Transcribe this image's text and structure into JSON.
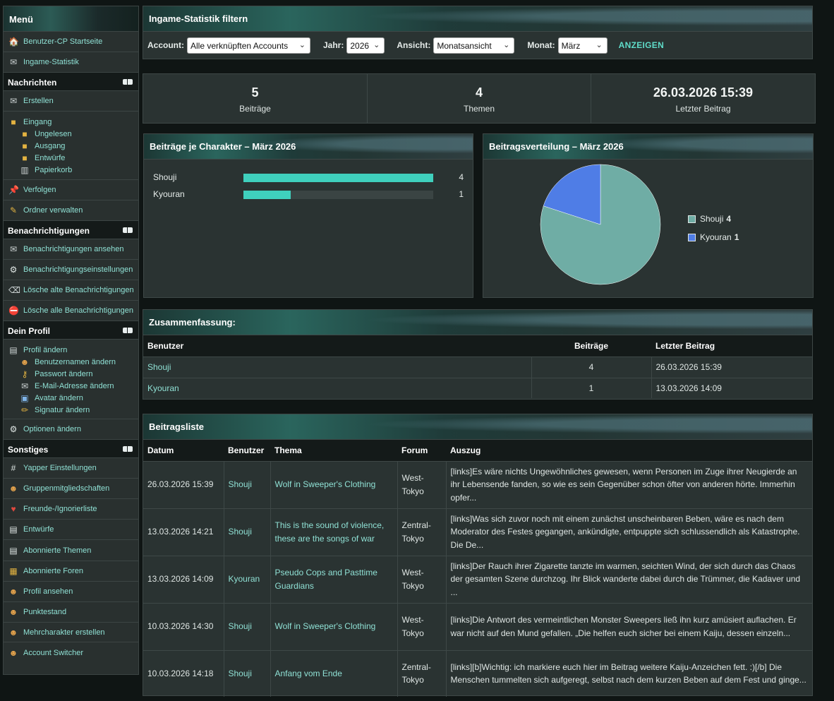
{
  "menu": {
    "title": "Menü",
    "top_items": [
      {
        "label": "Benutzer-CP Startseite",
        "icon": "🏠"
      },
      {
        "label": "Ingame-Statistik",
        "icon": "✉"
      }
    ],
    "nachrichten": {
      "title": "Nachrichten",
      "erstellen": "Erstellen",
      "eingang": "Eingang",
      "sub": [
        "Ungelesen",
        "Ausgang",
        "Entwürfe",
        "Papierkorb"
      ],
      "verfolgen": "Verfolgen",
      "ordner": "Ordner verwalten"
    },
    "benachrichtigungen": {
      "title": "Benachrichtigungen",
      "items": [
        "Benachrichtigungen ansehen",
        "Benachrichtigungseinstellungen",
        "Lösche alte Benachrichtigungen",
        "Lösche alle Benachrichtigungen"
      ]
    },
    "profil": {
      "title": "Dein Profil",
      "aendern": "Profil ändern",
      "sub": [
        "Benutzernamen ändern",
        "Passwort ändern",
        "E-Mail-Adresse ändern",
        "Avatar ändern",
        "Signatur ändern"
      ],
      "optionen": "Optionen ändern"
    },
    "sonstiges": {
      "title": "Sonstiges",
      "items": [
        "Yapper Einstellungen",
        "Gruppenmitgliedschaften",
        "Freunde-/Ignorierliste",
        "Entwürfe",
        "Abonnierte Themen",
        "Abonnierte Foren",
        "Profil ansehen",
        "Punktestand",
        "Mehrcharakter erstellen",
        "Account Switcher"
      ]
    }
  },
  "filter": {
    "title": "Ingame-Statistik filtern",
    "account_label": "Account:",
    "account_value": "Alle verknüpften Accounts",
    "jahr_label": "Jahr:",
    "jahr_value": "2026",
    "ansicht_label": "Ansicht:",
    "ansicht_value": "Monatsansicht",
    "monat_label": "Monat:",
    "monat_value": "März",
    "button": "ANZEIGEN"
  },
  "stats": [
    {
      "value": "5",
      "label": "Beiträge"
    },
    {
      "value": "4",
      "label": "Themen"
    },
    {
      "value": "26.03.2026 15:39",
      "label": "Letzter Beitrag"
    }
  ],
  "bar_panel_title": "Beiträge je Charakter – März 2026",
  "pie_panel_title": "Beitragsverteilung – März 2026",
  "chart_data": [
    {
      "type": "bar",
      "title": "Beiträge je Charakter – März 2026",
      "categories": [
        "Shouji",
        "Kyouran"
      ],
      "values": [
        4,
        1
      ],
      "max": 4,
      "colors": [
        "#3fd0bd"
      ]
    },
    {
      "type": "pie",
      "title": "Beitragsverteilung – März 2026",
      "categories": [
        "Shouji",
        "Kyouran"
      ],
      "values": [
        4,
        1
      ],
      "colors": [
        "#6fada5",
        "#4f7de6"
      ],
      "legend": "right"
    }
  ],
  "summary": {
    "title": "Zusammenfassung:",
    "headers": [
      "Benutzer",
      "Beiträge",
      "Letzter Beitrag"
    ],
    "rows": [
      {
        "user": "Shouji",
        "count": "4",
        "last": "26.03.2026 15:39"
      },
      {
        "user": "Kyouran",
        "count": "1",
        "last": "13.03.2026 14:09"
      }
    ]
  },
  "postlist": {
    "title": "Beitragsliste",
    "headers": [
      "Datum",
      "Benutzer",
      "Thema",
      "Forum",
      "Auszug"
    ],
    "rows": [
      {
        "date": "26.03.2026 15:39",
        "user": "Shouji",
        "topic": "Wolf in Sweeper's Clothing",
        "forum": "West-Tokyo",
        "excerpt": "[links]Es wäre nichts Ungewöhnliches gewesen, wenn Personen im Zuge ihrer Neugierde an ihr Lebensende fanden, so wie es sein Gegenüber schon öfter von anderen hörte. Immerhin opfer..."
      },
      {
        "date": "13.03.2026 14:21",
        "user": "Shouji",
        "topic": "This is the sound of violence, these are the songs of war",
        "forum": "Zentral-Tokyo",
        "excerpt": "[links]Was sich zuvor noch mit einem zunächst unscheinbaren Beben, wäre es nach dem Moderator des Festes gegangen, ankündigte, entpuppte sich schlussendlich als Katastrophe. Die De..."
      },
      {
        "date": "13.03.2026 14:09",
        "user": "Kyouran",
        "topic": "Pseudo Cops and Pasttime Guardians",
        "forum": "West-Tokyo",
        "excerpt": "[links]Der Rauch ihrer Zigarette tanzte im warmen, seichten Wind, der sich durch das Chaos der gesamten Szene durchzog. Ihr Blick wanderte dabei durch die Trümmer, die Kadaver und ..."
      },
      {
        "date": "10.03.2026 14:30",
        "user": "Shouji",
        "topic": "Wolf in Sweeper's Clothing",
        "forum": "West-Tokyo",
        "excerpt": "[links]Die Antwort des vermeintlichen Monster Sweepers ließ ihn kurz amüsiert auflachen. Er war nicht auf den Mund gefallen. „Die helfen euch sicher bei einem Kaiju, dessen einzeln..."
      },
      {
        "date": "10.03.2026 14:18",
        "user": "Shouji",
        "topic": "Anfang vom Ende",
        "forum": "Zentral-Tokyo",
        "excerpt": "[links][b]Wichtig: ich markiere euch hier im Beitrag weitere Kaiju-Anzeichen fett. :)[/b] Die Menschen tummelten sich aufgeregt, selbst nach dem kurzen Beben auf dem Fest und ginge..."
      }
    ]
  }
}
